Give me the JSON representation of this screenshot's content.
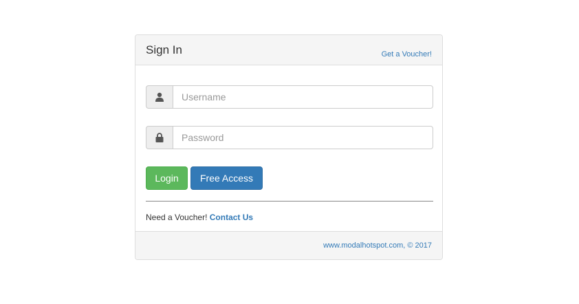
{
  "panel": {
    "title": "Sign In",
    "voucher_link": "Get a Voucher!"
  },
  "form": {
    "username": {
      "icon": "user-icon",
      "placeholder": "Username",
      "value": ""
    },
    "password": {
      "icon": "lock-icon",
      "placeholder": "Password",
      "value": ""
    },
    "login_label": "Login",
    "free_access_label": "Free Access"
  },
  "voucher_note": {
    "text": "Need a Voucher!",
    "contact_label": "Contact Us"
  },
  "footer": {
    "text": "www.modalhotspot.com, © 2017"
  },
  "colors": {
    "primary": "#337ab7",
    "success": "#5cb85c",
    "heading_bg": "#f5f5f5",
    "border": "#dddddd"
  }
}
